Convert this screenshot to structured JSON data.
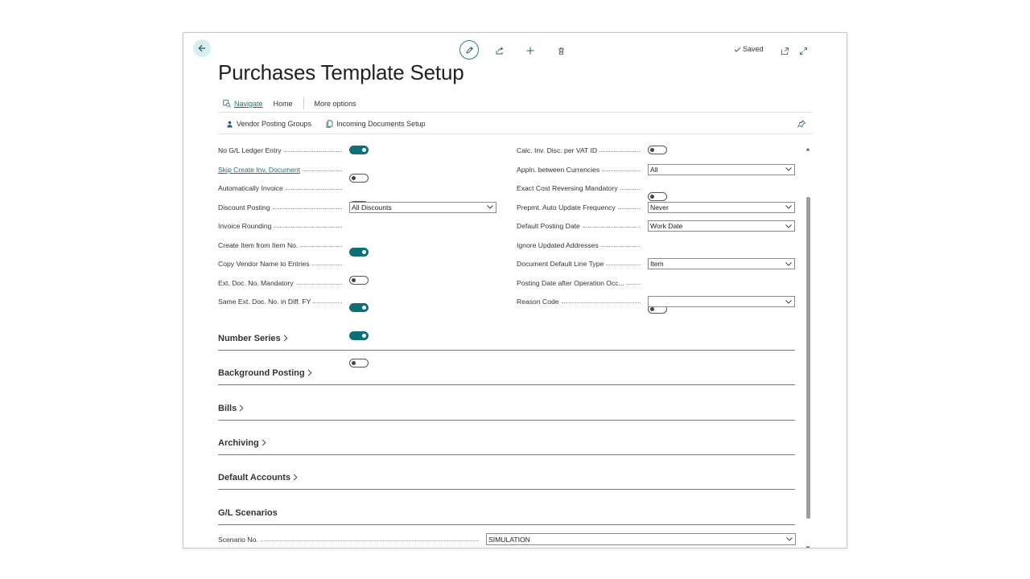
{
  "header": {
    "saved_label": "Saved"
  },
  "page": {
    "title": "Purchases Template Setup"
  },
  "actions": {
    "navigate": "Navigate",
    "home": "Home",
    "more": "More options"
  },
  "subactions": {
    "vendor_posting_groups": "Vendor Posting Groups",
    "incoming_documents_setup": "Incoming Documents Setup"
  },
  "left_fields": [
    {
      "label": "No G/L Ledger Entry",
      "type": "toggle",
      "on": true
    },
    {
      "label": "Skip Create Inv. Document",
      "type": "toggle",
      "on": false,
      "link": true
    },
    {
      "label": "Automatically Invoice",
      "type": "toggle",
      "on": false
    },
    {
      "label": "Discount Posting",
      "type": "select",
      "value": "All Discounts"
    },
    {
      "label": "Invoice Rounding",
      "type": "toggle",
      "on": true
    },
    {
      "label": "Create Item from Item No.",
      "type": "toggle",
      "on": false
    },
    {
      "label": "Copy Vendor Name to Entries",
      "type": "toggle",
      "on": true
    },
    {
      "label": "Ext. Doc. No. Mandatory",
      "type": "toggle",
      "on": true
    },
    {
      "label": "Same Ext. Doc. No. in Diff. FY",
      "type": "toggle",
      "on": false
    }
  ],
  "right_fields": [
    {
      "label": "Calc. Inv. Disc. per VAT ID",
      "type": "toggle",
      "on": false
    },
    {
      "label": "Appln. between Currencies",
      "type": "select",
      "value": "All"
    },
    {
      "label": "Exact Cost Reversing Mandatory",
      "type": "toggle",
      "on": false
    },
    {
      "label": "Prepmt. Auto Update Frequency",
      "type": "select",
      "value": "Never"
    },
    {
      "label": "Default Posting Date",
      "type": "select",
      "value": "Work Date"
    },
    {
      "label": "Ignore Updated Addresses",
      "type": "toggle",
      "on": false
    },
    {
      "label": "Document Default Line Type",
      "type": "select",
      "value": "Item"
    },
    {
      "label": "Posting Date after Operation Occ...",
      "type": "toggle",
      "on": false
    },
    {
      "label": "Reason Code",
      "type": "select",
      "value": ""
    }
  ],
  "sections": [
    "Number Series",
    "Background Posting",
    "Bills",
    "Archiving",
    "Default Accounts"
  ],
  "gl_scenarios": {
    "title": "G/L Scenarios",
    "scenario_label": "Scenario No.",
    "scenario_value": "SIMULATION"
  },
  "colors": {
    "accent": "#0e6f77",
    "link": "#1f6f78"
  }
}
